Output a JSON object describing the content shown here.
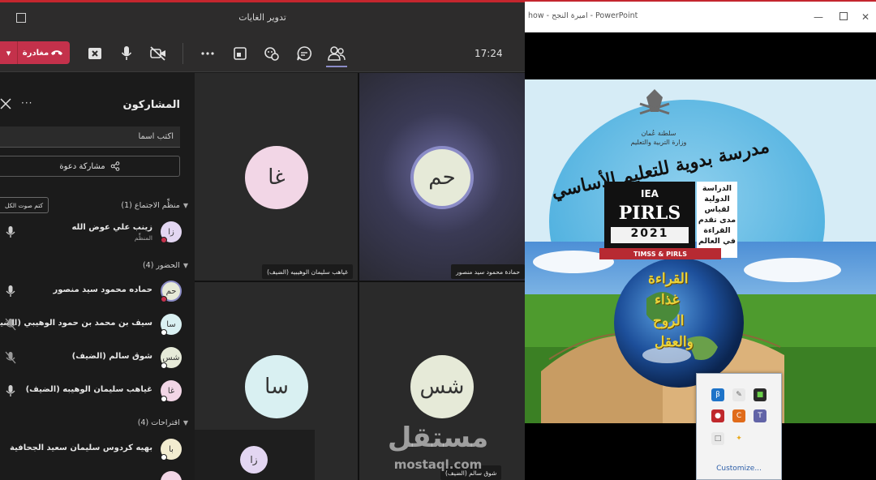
{
  "teams": {
    "window_title": "تدوير الغايات",
    "toolbar": {
      "leave_label": "مغادرة",
      "time": "17:24"
    },
    "panel": {
      "title": "المشاركون",
      "search_placeholder": "اكتب اسماً",
      "invite_label": "مشاركة دعوة",
      "mute_all_label": "كتم صوت الكل",
      "sections": [
        {
          "label": "منظِّم الاجتماع (1)"
        },
        {
          "label": "الحضور (4)"
        },
        {
          "label": "اقتراحات (4)"
        }
      ],
      "participants": [
        {
          "initials": "زا",
          "name": "زينب علي عوض الله",
          "role": "المنظِّم",
          "color": "#e3d6f2",
          "mic": "on",
          "dot": "#c4314b"
        },
        {
          "initials": "حم",
          "name": "حماده محمود سيد منصور",
          "role": "",
          "color": "#e6ead8",
          "mic": "on",
          "dot": "#c4314b"
        },
        {
          "initials": "سا",
          "name": "سيف بن محمد بن حمود الوهيبي (الضيف)",
          "role": "",
          "color": "#d9f0f2",
          "mic": "off",
          "dot": "#ffffff"
        },
        {
          "initials": "شس",
          "name": "شوق سالم (الضيف)",
          "role": "",
          "color": "#e6ead8",
          "mic": "off",
          "dot": "#ffffff"
        },
        {
          "initials": "غا",
          "name": "غياهب سليمان الوهيبه (الضيف)",
          "role": "",
          "color": "#f2d6e6",
          "mic": "on",
          "dot": "#ffffff"
        },
        {
          "initials": "با",
          "name": "بهيه كردوس سليمان سعيد الجحافية",
          "role": "",
          "color": "#f2ecd0",
          "mic": "none",
          "dot": "#ffffff"
        }
      ]
    },
    "tiles": [
      {
        "initials": "حم",
        "label": "حمادة محمود سيد منصور",
        "color": "#e6ead8"
      },
      {
        "initials": "غا",
        "label": "غياهب سليمان الوهيبيه (الضيف)",
        "color": "#f2d6e6"
      },
      {
        "initials": "شس",
        "label": "شوق سالم (الضيف)",
        "color": "#e6ead8"
      },
      {
        "initials": "سا",
        "label": "",
        "color": "#d9f0f2"
      },
      {
        "initials": "زا",
        "label": "",
        "color": "#e3d6f2"
      }
    ]
  },
  "ppt": {
    "window_title": "how - اميرة النجح - PowerPoint",
    "slide": {
      "headline": "مدرسة بدوية للتعليم الأساسي",
      "ministry_line1": "سلطنة عُمان",
      "ministry_line2": "وزارة التربية والتعليم",
      "iea": "IEA",
      "pirls": "PIRLS",
      "year": "2021",
      "timss": "TIMSS & PIRLS",
      "study_text": "الدراسة الدولية لقياس مدى تقدم القراءة في العالم",
      "quote_lines": [
        "القراءة",
        "غذاء",
        "الروح",
        "والعقل"
      ]
    },
    "tray": {
      "customize_label": "Customize..."
    }
  },
  "watermark": {
    "word": "مستقل",
    "url": "mostaql.com"
  },
  "colors": {
    "teams_accent": "#8b8cc7",
    "leave_red": "#c4314b",
    "ppt_red": "#b72a32"
  }
}
